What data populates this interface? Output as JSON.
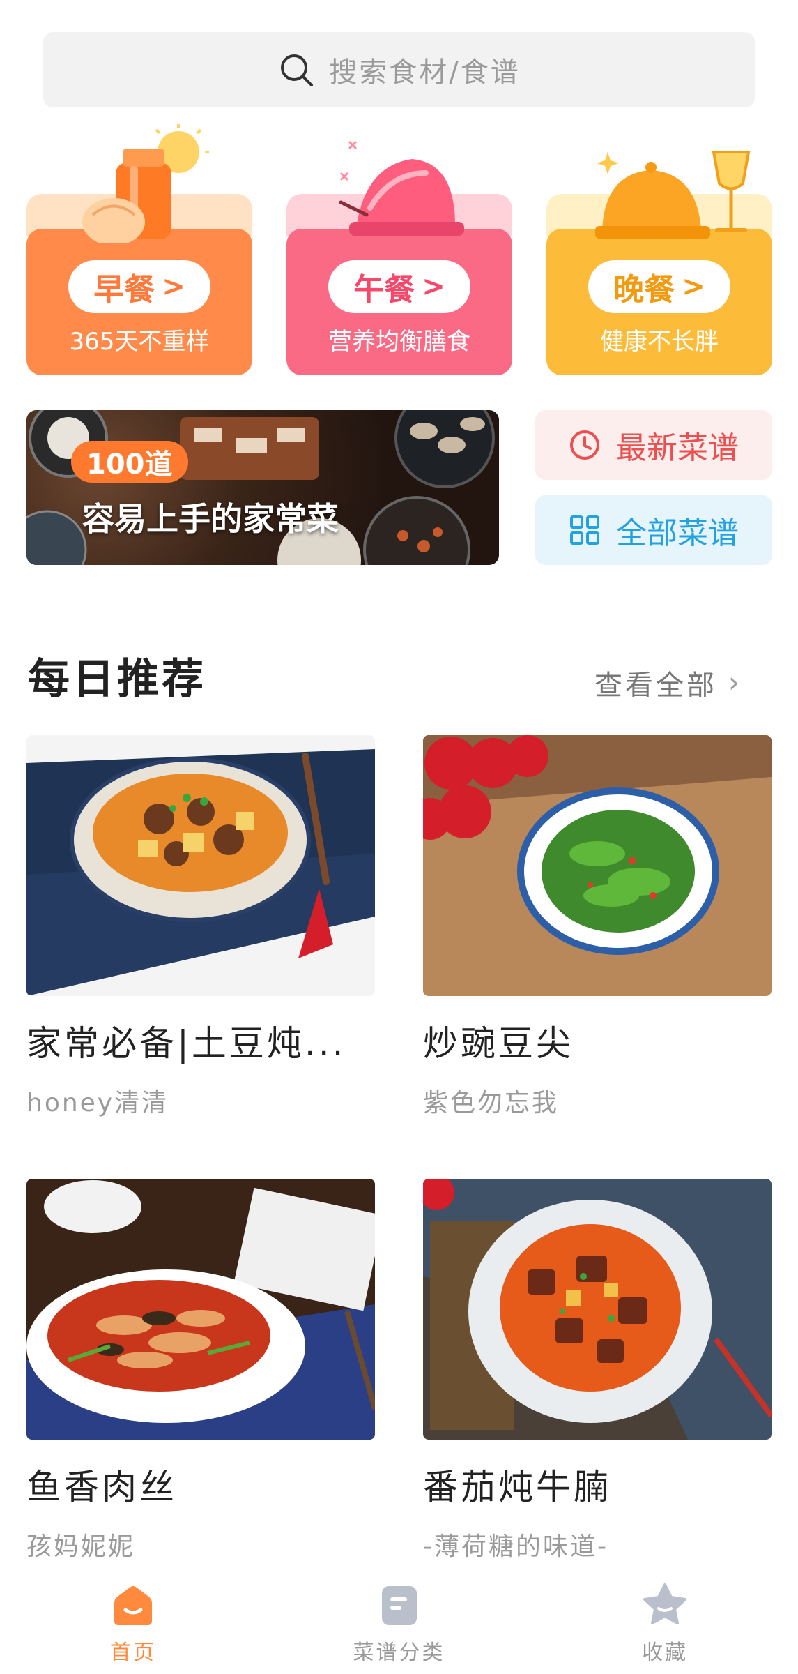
{
  "search": {
    "placeholder": "搜索食材/食谱",
    "icon": "search-icon"
  },
  "meals": [
    {
      "label": "早餐",
      "subtitle": "365天不重样",
      "color": "#ff8a4a"
    },
    {
      "label": "午餐",
      "subtitle": "营养均衡膳食",
      "color": "#fb6a84"
    },
    {
      "label": "晚餐",
      "subtitle": "健康不长胖",
      "color": "#fdbb3a"
    }
  ],
  "banner": {
    "badge": "100道",
    "headline": "容易上手的家常菜"
  },
  "quick_links": {
    "newest": {
      "label": "最新菜谱",
      "icon": "clock-icon",
      "color": "#ec4f4f"
    },
    "all": {
      "label": "全部菜谱",
      "icon": "grid-icon",
      "color": "#24a1e0"
    }
  },
  "daily": {
    "title": "每日推荐",
    "see_all": "查看全部",
    "recipes": [
      {
        "title": "家常必备|土豆炖...",
        "author": "honey清清"
      },
      {
        "title": "炒豌豆尖",
        "author": "紫色勿忘我"
      },
      {
        "title": "鱼香肉丝",
        "author": "孩妈妮妮"
      },
      {
        "title": "番茄炖牛腩",
        "author": "-薄荷糖的味道-"
      }
    ]
  },
  "nav": {
    "items": [
      {
        "label": "首页",
        "icon": "home-icon",
        "active": true
      },
      {
        "label": "菜谱分类",
        "icon": "recipe-book-icon",
        "active": false
      },
      {
        "label": "收藏",
        "icon": "star-icon",
        "active": false
      }
    ],
    "active_color": "#ff8a3d"
  }
}
